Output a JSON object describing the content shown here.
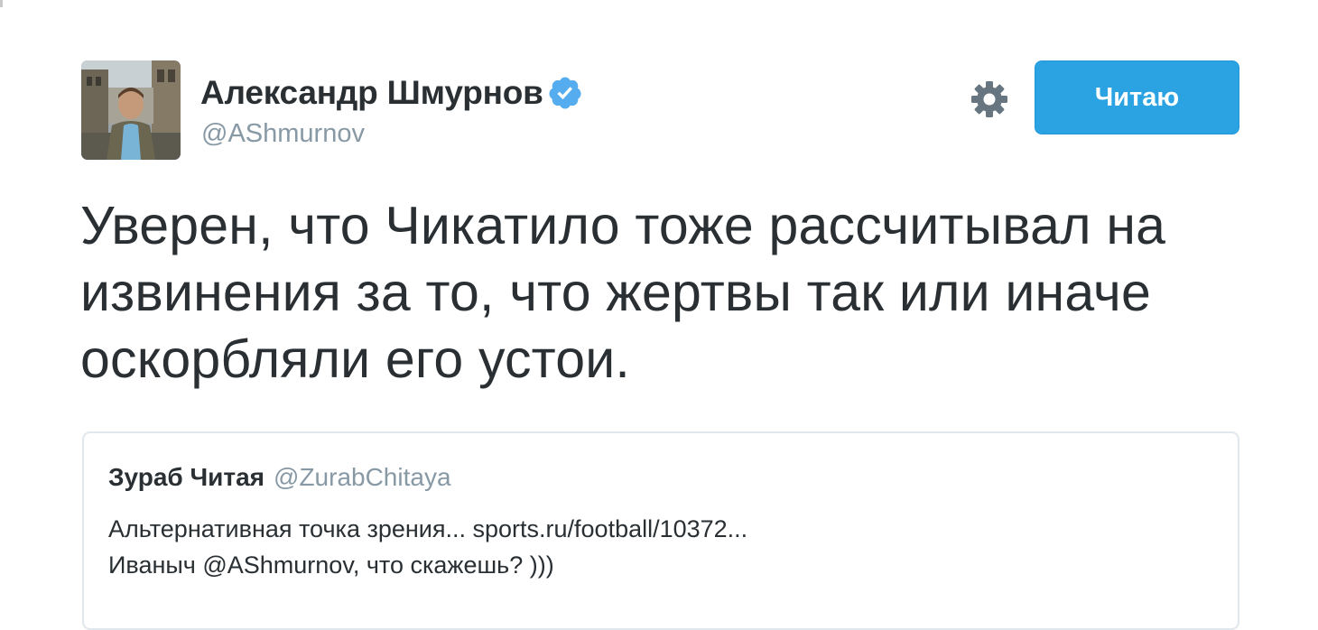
{
  "tweet": {
    "author": {
      "name": "Александр Шмурнов",
      "username": "@AShmurnov",
      "verified": true
    },
    "follow_button_label": "Читаю",
    "text_lines": [
      "Уверен, что Чикатило тоже рассчитывал на",
      "извинения за то, что жертвы так или иначе",
      "оскорбляли его устои."
    ],
    "quoted": {
      "name": "Зураб Читая",
      "username": "@ZurabChitaya",
      "text_lines": [
        "Альтернативная точка зрения... sports.ru/football/10372...",
        "Иваныч @AShmurnov, что скажешь? )))"
      ]
    }
  },
  "colors": {
    "accent": "#2ba3e3",
    "verified": "#55acee",
    "secondary_text": "#8899a6",
    "primary_text": "#292f33",
    "card_border": "#e1e8ed"
  },
  "icons": {
    "verified": "verified-badge-icon",
    "settings": "gear-icon"
  }
}
